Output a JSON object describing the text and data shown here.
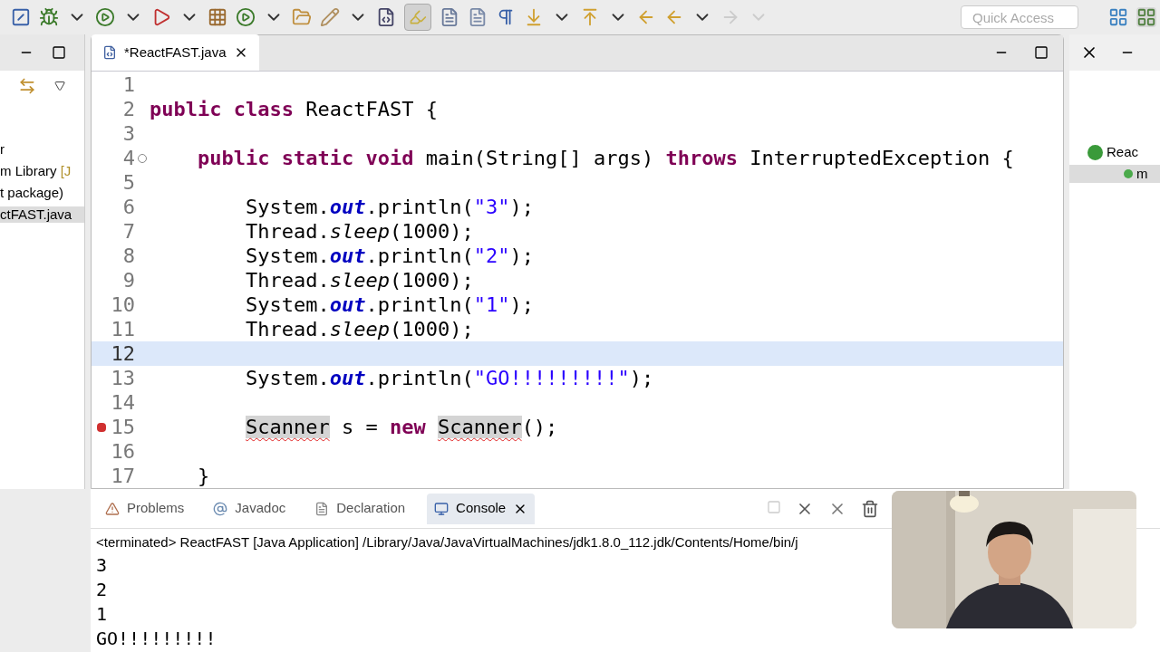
{
  "toolbar": {
    "highlight_toggle_on": true
  },
  "quick_access": {
    "placeholder": "Quick Access"
  },
  "package_explorer": {
    "items": [
      {
        "label": "r",
        "selected": false
      },
      {
        "label": "m Library",
        "suffix": "[J",
        "selected": false
      },
      {
        "label": "t package)",
        "selected": false
      },
      {
        "label": "ctFAST.java",
        "selected": true
      }
    ]
  },
  "editor": {
    "tab": {
      "title": "*ReactFAST.java",
      "selected": true
    },
    "lines": [
      {
        "number": "1",
        "current": false
      },
      {
        "number": "2",
        "current": false,
        "tokens": [
          {
            "kind": "keyword",
            "text": "public "
          },
          {
            "kind": "keyword",
            "text": "class"
          },
          {
            "kind": "plain",
            "text": " ReactFAST {"
          }
        ]
      },
      {
        "number": "3",
        "current": false
      },
      {
        "number": "4",
        "current": false,
        "kind": "fold",
        "tokens": [
          {
            "kind": "keyword",
            "text": "    public "
          },
          {
            "kind": "keyword",
            "text": "static "
          },
          {
            "kind": "keyword",
            "text": "void"
          },
          {
            "kind": "plain",
            "text": " main(String[] args) "
          },
          {
            "kind": "keyword",
            "text": "throws"
          },
          {
            "kind": "plain",
            "text": " InterruptedException {"
          }
        ]
      },
      {
        "number": "5",
        "current": false
      },
      {
        "number": "6",
        "current": false,
        "tokens": [
          {
            "kind": "plain",
            "text": "        System."
          },
          {
            "kind": "field",
            "text": "out"
          },
          {
            "kind": "plain",
            "text": ".println("
          },
          {
            "kind": "string",
            "text": "\"3\""
          },
          {
            "kind": "plain",
            "text": ");"
          }
        ]
      },
      {
        "number": "7",
        "current": false,
        "tokens": [
          {
            "kind": "plain",
            "text": "        Thread."
          },
          {
            "kind": "method",
            "text": "sleep"
          },
          {
            "kind": "plain",
            "text": "(1000);"
          }
        ]
      },
      {
        "number": "8",
        "current": false,
        "tokens": [
          {
            "kind": "plain",
            "text": "        System."
          },
          {
            "kind": "field",
            "text": "out"
          },
          {
            "kind": "plain",
            "text": ".println("
          },
          {
            "kind": "string",
            "text": "\"2\""
          },
          {
            "kind": "plain",
            "text": ");"
          }
        ]
      },
      {
        "number": "9",
        "current": false,
        "tokens": [
          {
            "kind": "plain",
            "text": "        Thread."
          },
          {
            "kind": "method",
            "text": "sleep"
          },
          {
            "kind": "plain",
            "text": "(1000);"
          }
        ]
      },
      {
        "number": "10",
        "current": false,
        "tokens": [
          {
            "kind": "plain",
            "text": "        System."
          },
          {
            "kind": "field",
            "text": "out"
          },
          {
            "kind": "plain",
            "text": ".println("
          },
          {
            "kind": "string",
            "text": "\"1\""
          },
          {
            "kind": "plain",
            "text": ");"
          }
        ]
      },
      {
        "number": "11",
        "current": false,
        "tokens": [
          {
            "kind": "plain",
            "text": "        Thread."
          },
          {
            "kind": "method",
            "text": "sleep"
          },
          {
            "kind": "plain",
            "text": "(1000);"
          }
        ]
      },
      {
        "number": "12",
        "current": true
      },
      {
        "number": "13",
        "current": false,
        "tokens": [
          {
            "kind": "plain",
            "text": "        System."
          },
          {
            "kind": "field",
            "text": "out"
          },
          {
            "kind": "plain",
            "text": ".println("
          },
          {
            "kind": "string",
            "text": "\"GO!!!!!!!!!\""
          },
          {
            "kind": "plain",
            "text": ");"
          }
        ]
      },
      {
        "number": "14",
        "current": false
      },
      {
        "number": "15",
        "current": false,
        "kind": "error",
        "tokens": [
          {
            "kind": "error",
            "text": "        Scanner"
          },
          {
            "kind": "plain",
            "text": " s = "
          },
          {
            "kind": "keyword",
            "text": "new "
          },
          {
            "kind": "error",
            "text": "Scanner"
          },
          {
            "kind": "plain",
            "text": "();"
          }
        ]
      },
      {
        "number": "16",
        "current": false
      },
      {
        "number": "17",
        "current": false,
        "tokens": [
          {
            "kind": "plain",
            "text": "    }"
          }
        ]
      }
    ]
  },
  "outline": {
    "items": [
      {
        "label": "Reac",
        "kind": "class",
        "selected": false
      },
      {
        "label": "m",
        "kind": "method",
        "selected": true
      }
    ]
  },
  "bottom_panel": {
    "tabs": [
      {
        "label": "Problems",
        "selected": false
      },
      {
        "label": "Javadoc",
        "selected": false
      },
      {
        "label": "Declaration",
        "selected": false
      },
      {
        "label": "Console",
        "selected": true
      }
    ],
    "console_header": "<terminated> ReactFAST [Java Application] /Library/Java/JavaVirtualMachines/jdk1.8.0_112.jdk/Contents/Home/bin/j",
    "output": [
      "3",
      "2",
      "1",
      "GO!!!!!!!!!"
    ]
  }
}
